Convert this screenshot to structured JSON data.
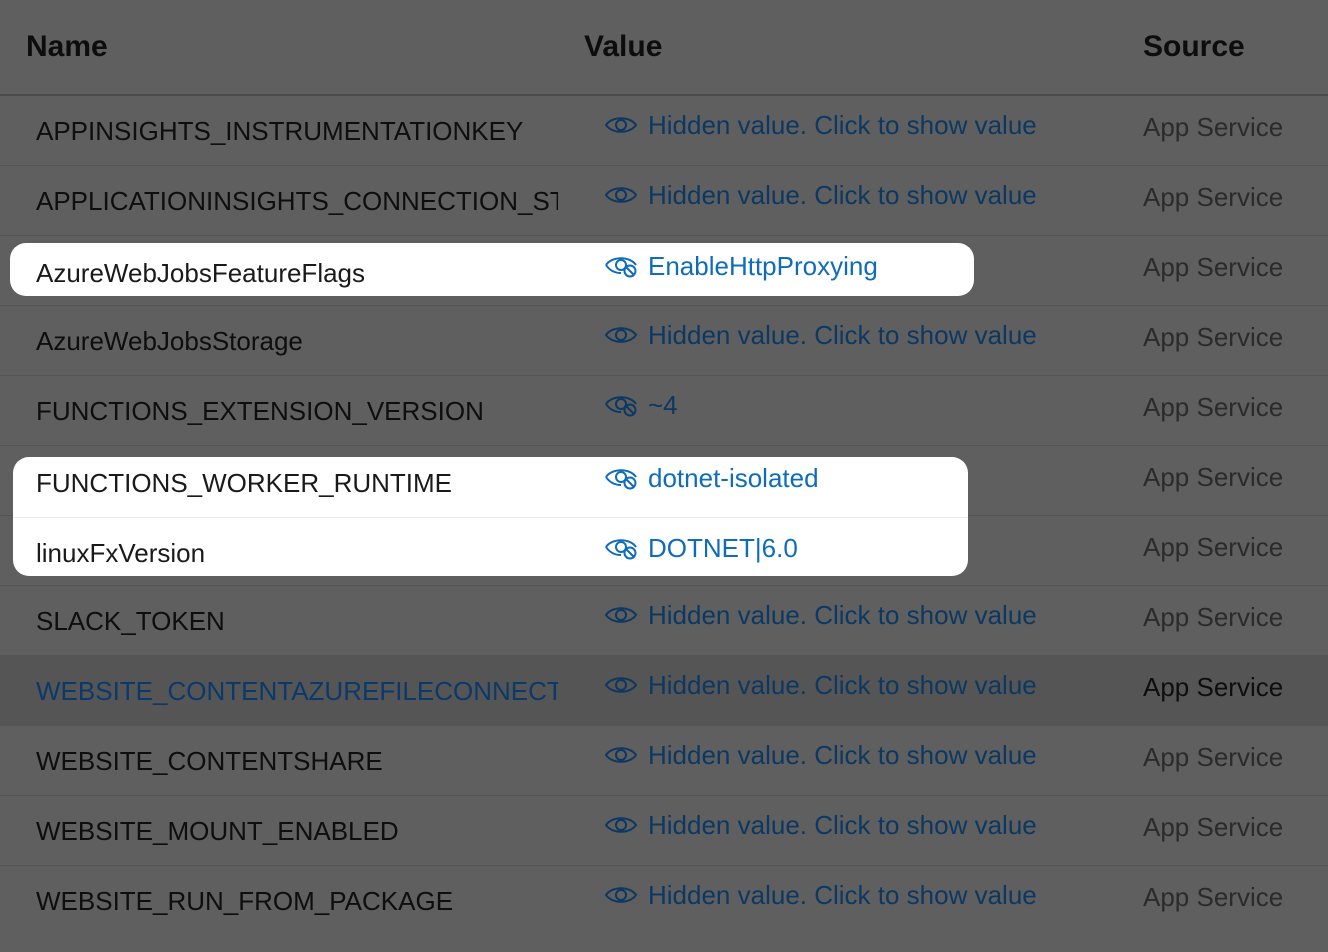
{
  "columns": {
    "name": "Name",
    "value": "Value",
    "source": "Source"
  },
  "rows": [
    {
      "name": "APPINSIGHTS_INSTRUMENTATIONKEY",
      "value": "Hidden value. Click to show value",
      "source": "App Service",
      "icon": "eye-icon"
    },
    {
      "name": "APPLICATIONINSIGHTS_CONNECTION_STRIN",
      "value": "Hidden value. Click to show value",
      "source": "App Service",
      "icon": "eye-icon"
    },
    {
      "name": "AzureWebJobsFeatureFlags",
      "value": "EnableHttpProxying",
      "source": "App Service",
      "icon": "eye-hide-icon"
    },
    {
      "name": "AzureWebJobsStorage",
      "value": "Hidden value. Click to show value",
      "source": "App Service",
      "icon": "eye-icon"
    },
    {
      "name": "FUNCTIONS_EXTENSION_VERSION",
      "value": "~4",
      "source": "App Service",
      "icon": "eye-hide-icon"
    },
    {
      "name": "FUNCTIONS_WORKER_RUNTIME",
      "value": "dotnet-isolated",
      "source": "App Service",
      "icon": "eye-hide-icon"
    },
    {
      "name": "linuxFxVersion",
      "value": "DOTNET|6.0",
      "source": "App Service",
      "icon": "eye-hide-icon"
    },
    {
      "name": "SLACK_TOKEN",
      "value": "Hidden value. Click to show value",
      "source": "App Service",
      "icon": "eye-icon"
    },
    {
      "name": "WEBSITE_CONTENTAZUREFILECONNECTIONS",
      "value": "Hidden value. Click to show value",
      "source": "App Service",
      "icon": "eye-icon"
    },
    {
      "name": "WEBSITE_CONTENTSHARE",
      "value": "Hidden value. Click to show value",
      "source": "App Service",
      "icon": "eye-icon"
    },
    {
      "name": "WEBSITE_MOUNT_ENABLED",
      "value": "Hidden value. Click to show value",
      "source": "App Service",
      "icon": "eye-icon"
    },
    {
      "name": "WEBSITE_RUN_FROM_PACKAGE",
      "value": "Hidden value. Click to show value",
      "source": "App Service",
      "icon": "eye-icon"
    }
  ],
  "colors": {
    "overlay": "#5f5f5f",
    "link": "#0f6cbd",
    "highlight": "#ffffff"
  }
}
